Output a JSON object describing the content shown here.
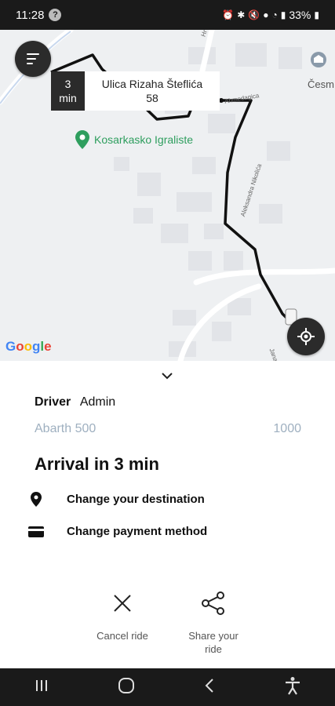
{
  "status_bar": {
    "time": "11:28",
    "notification_glyph": "?",
    "battery": "33%",
    "icons": [
      "alarm-icon",
      "bluetooth-icon",
      "mute-icon",
      "location-icon",
      "wifi-icon",
      "signal-icon",
      "battery-icon"
    ]
  },
  "map": {
    "eta_line1": "3",
    "eta_line2": "min",
    "destination_line1": "Ulica Rizaha Šteflića",
    "destination_line2": "58",
    "poi_label": "Kosarkasko Igraliste",
    "top_right_place": "Česm",
    "street_labels": [
      "Ahmedagica",
      "Aleksandra Nikolića",
      "Hr",
      "Jana"
    ],
    "logo_text": "Google",
    "logo_colors": [
      "#4285F4",
      "#EA4335",
      "#FBBC05",
      "#4285F4",
      "#34A853",
      "#EA4335"
    ],
    "route_color": "#111111"
  },
  "sheet": {
    "driver_label": "Driver",
    "driver_name": "Admin",
    "car_model": "Abarth 500",
    "car_number": "1000",
    "arrival_text": "Arrival in 3 min",
    "options": [
      {
        "label": "Change your destination",
        "icon": "location-pin-icon"
      },
      {
        "label": "Change payment method",
        "icon": "credit-card-icon"
      }
    ],
    "actions": {
      "cancel_label": "Cancel ride",
      "share_label_line1": "Share your",
      "share_label_line2": "ride"
    }
  },
  "nav_bar": {
    "buttons": [
      "recents-icon",
      "home-icon",
      "back-icon",
      "accessibility-icon"
    ]
  },
  "colors": {
    "dark_button": "#2b2b2b",
    "poi_green": "#2e9e5e",
    "muted_text": "#9fb0c0"
  }
}
